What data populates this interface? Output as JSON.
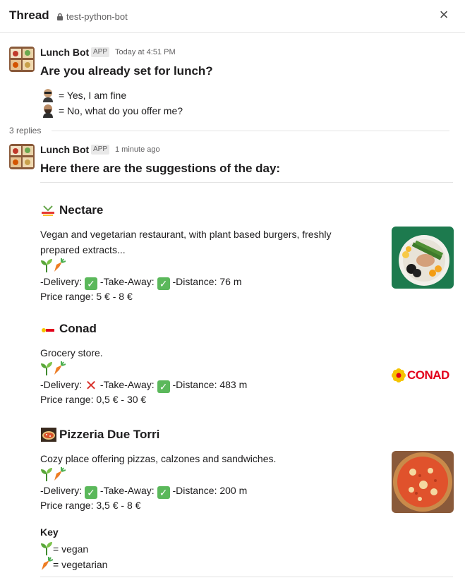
{
  "header": {
    "title": "Thread",
    "channel": "test-python-bot",
    "close_label": "×"
  },
  "message1": {
    "sender": "Lunch Bot",
    "badge": "APP",
    "time": "Today at 4:51 PM",
    "question": "Are you already set for lunch?",
    "options": [
      {
        "text": "= Yes, I am fine"
      },
      {
        "text": "= No, what do you offer me?"
      }
    ]
  },
  "replies_count": "3 replies",
  "message2": {
    "sender": "Lunch Bot",
    "badge": "APP",
    "time": "1 minute ago",
    "heading": "Here there are the suggestions of the day:",
    "restaurants": [
      {
        "name": "Nectare",
        "desc": "Vegan and vegetarian restaurant, with plant based burgers, freshly prepared extracts...",
        "delivery_label": " -Delivery: ",
        "delivery": true,
        "takeaway_label": " -Take-Away: ",
        "takeaway": true,
        "distance": " -Distance: 76 m",
        "price": "Price range: 5 € - 8 €"
      },
      {
        "name": "Conad",
        "desc": "Grocery store.",
        "delivery_label": " -Delivery: ",
        "delivery": false,
        "takeaway_label": " -Take-Away: ",
        "takeaway": true,
        "distance": " -Distance: 483 m",
        "price": "Price range: 0,5 € - 30 €",
        "logo_text": "CONAD"
      },
      {
        "name": "Pizzeria Due Torri",
        "desc": "Cozy place offering pizzas, calzones and sandwiches.",
        "delivery_label": " -Delivery: ",
        "delivery": true,
        "takeaway_label": " -Take-Away: ",
        "takeaway": true,
        "distance": " -Distance: 200 m",
        "price": "Price range: 3,5 € - 8 €"
      }
    ],
    "key": {
      "title": "Key",
      "vegan": "= vegan",
      "vegetarian": "= vegetarian"
    }
  },
  "colors": {
    "check": "#5bb85b",
    "cross": "#d9322c",
    "conad_red": "#e2001a",
    "conad_yellow": "#f5c400"
  }
}
